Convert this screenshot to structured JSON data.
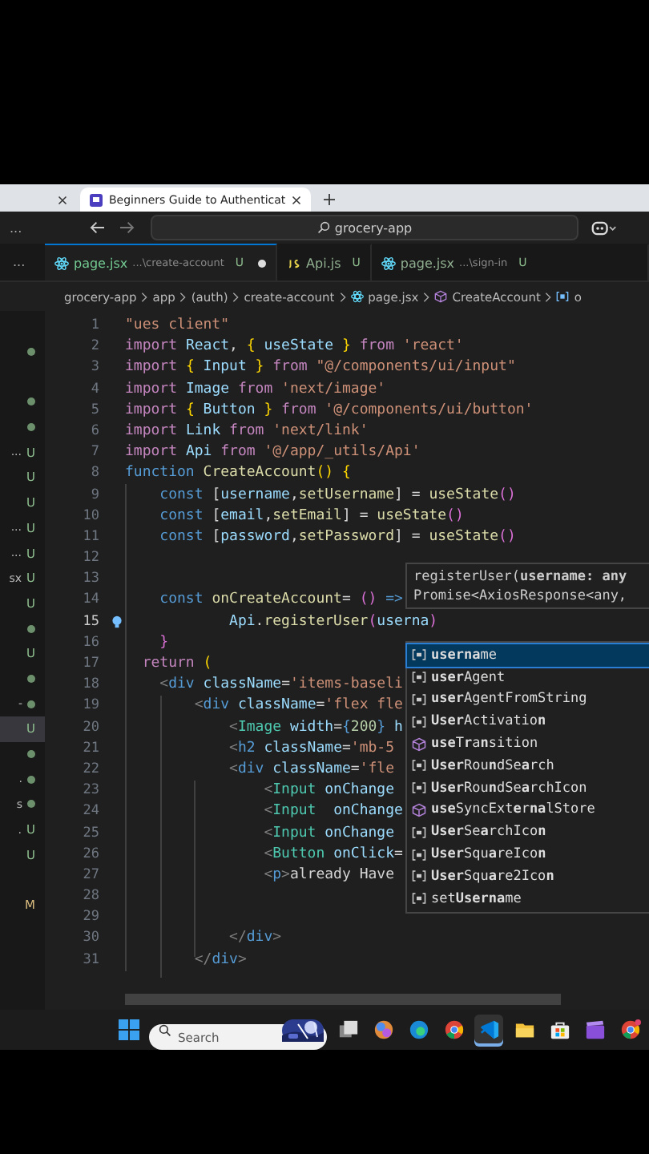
{
  "browser": {
    "tabs": [
      {
        "selected": false
      },
      {
        "title": "Beginners Guide to Authenticat",
        "selected": true
      }
    ]
  },
  "titlebar": {
    "menu": "...",
    "search": "grocery-app"
  },
  "tabs_menu": "...",
  "tabs": [
    {
      "kind": "react",
      "label": "page.jsx",
      "path": "...\\create-account",
      "status": "U",
      "dirty": true,
      "selected": true
    },
    {
      "kind": "js",
      "label": "Api.js",
      "status": "U",
      "dirty": false,
      "selected": false
    },
    {
      "kind": "react",
      "label": "page.jsx",
      "path": "...\\sign-in",
      "status": "U",
      "dirty": false,
      "selected": false
    }
  ],
  "breadcrumbs": [
    {
      "label": "grocery-app"
    },
    {
      "label": "app"
    },
    {
      "label": "(auth)"
    },
    {
      "label": "create-account"
    },
    {
      "kind": "react",
      "label": "page.jsx"
    },
    {
      "kind": "cube",
      "label": "CreateAccount"
    },
    {
      "kind": "var",
      "label": "o"
    }
  ],
  "sidebar": [
    {
      "kind": "empty",
      "selected": false
    },
    {
      "kind": "dot",
      "selected": false
    },
    {
      "kind": "empty",
      "selected": false
    },
    {
      "kind": "dot",
      "selected": false
    },
    {
      "kind": "dot",
      "selected": false
    },
    {
      "kind": "untracked",
      "prefix": "...",
      "status": "U",
      "selected": false
    },
    {
      "kind": "untracked",
      "status": "U",
      "selected": false
    },
    {
      "kind": "untracked",
      "status": "U",
      "selected": false
    },
    {
      "kind": "untracked",
      "prefix": "...",
      "status": "U",
      "selected": false
    },
    {
      "kind": "untracked",
      "prefix": "...",
      "status": "U",
      "selected": false
    },
    {
      "kind": "untracked",
      "prefix": "sx",
      "status": "U",
      "selected": false
    },
    {
      "kind": "untracked",
      "status": "U",
      "selected": false
    },
    {
      "kind": "dot",
      "selected": false
    },
    {
      "kind": "untracked",
      "status": "U",
      "selected": false
    },
    {
      "kind": "dot",
      "selected": false
    },
    {
      "kind": "dot",
      "prefix": "-",
      "selected": false
    },
    {
      "kind": "untracked",
      "status": "U",
      "selected": true
    },
    {
      "kind": "dot",
      "selected": false
    },
    {
      "kind": "dot",
      "prefix": ".",
      "selected": false
    },
    {
      "kind": "dot",
      "prefix": "s",
      "selected": false
    },
    {
      "kind": "untracked",
      "prefix": ".",
      "status": "U",
      "selected": false
    },
    {
      "kind": "untracked",
      "status": "U",
      "selected": false
    },
    {
      "kind": "empty",
      "selected": false
    },
    {
      "kind": "modified",
      "status": "M",
      "selected": false
    }
  ],
  "code": [
    {
      "n": "1",
      "tokens": [
        {
          "text": "\"ues client\"",
          "kind": "s"
        }
      ]
    },
    {
      "n": "2",
      "tokens": [
        {
          "text": "import ",
          "kind": "c"
        },
        {
          "text": "React",
          "kind": "v"
        },
        {
          "text": ", ",
          "kind": "p"
        },
        {
          "text": "{",
          "kind": "b"
        },
        {
          "text": " useState ",
          "kind": "v"
        },
        {
          "text": "}",
          "kind": "b"
        },
        {
          "text": " from ",
          "kind": "c"
        },
        {
          "text": "'react'",
          "kind": "s"
        }
      ]
    },
    {
      "n": "3",
      "tokens": [
        {
          "text": "import ",
          "kind": "c"
        },
        {
          "text": "{",
          "kind": "b"
        },
        {
          "text": " Input ",
          "kind": "v"
        },
        {
          "text": "}",
          "kind": "b"
        },
        {
          "text": " from ",
          "kind": "c"
        },
        {
          "text": "\"@/components/ui/input\"",
          "kind": "s"
        }
      ]
    },
    {
      "n": "4",
      "tokens": [
        {
          "text": "import ",
          "kind": "c"
        },
        {
          "text": "Image",
          "kind": "v"
        },
        {
          "text": " from ",
          "kind": "c"
        },
        {
          "text": "'next/image'",
          "kind": "s"
        }
      ]
    },
    {
      "n": "5",
      "tokens": [
        {
          "text": "import ",
          "kind": "c"
        },
        {
          "text": "{",
          "kind": "b"
        },
        {
          "text": " Button ",
          "kind": "v"
        },
        {
          "text": "}",
          "kind": "b"
        },
        {
          "text": " from ",
          "kind": "c"
        },
        {
          "text": "'@/components/ui/button'",
          "kind": "s"
        }
      ]
    },
    {
      "n": "6",
      "tokens": [
        {
          "text": "import ",
          "kind": "c"
        },
        {
          "text": "Link",
          "kind": "v"
        },
        {
          "text": " from ",
          "kind": "c"
        },
        {
          "text": "'next/link'",
          "kind": "s"
        }
      ]
    },
    {
      "n": "7",
      "tokens": [
        {
          "text": "import ",
          "kind": "c"
        },
        {
          "text": "Api",
          "kind": "v"
        },
        {
          "text": " from ",
          "kind": "c"
        },
        {
          "text": "'@/app/_utils/Api'",
          "kind": "s"
        }
      ]
    },
    {
      "n": "8",
      "tokens": [
        {
          "text": "function ",
          "kind": "k"
        },
        {
          "text": "CreateAccount",
          "kind": "f"
        },
        {
          "text": "() ",
          "kind": "b"
        },
        {
          "text": "{",
          "kind": "b"
        }
      ]
    },
    {
      "n": "9",
      "tokens": [
        {
          "text": "    const ",
          "kind": "k"
        },
        {
          "text": "[",
          "kind": "p"
        },
        {
          "text": "username",
          "kind": "v"
        },
        {
          "text": ",",
          "kind": "p"
        },
        {
          "text": "setUsername",
          "kind": "f"
        },
        {
          "text": "] = ",
          "kind": "p"
        },
        {
          "text": "useState",
          "kind": "f"
        },
        {
          "text": "()",
          "kind": "m"
        }
      ]
    },
    {
      "n": "10",
      "tokens": [
        {
          "text": "    const ",
          "kind": "k"
        },
        {
          "text": "[",
          "kind": "p"
        },
        {
          "text": "email",
          "kind": "v"
        },
        {
          "text": ",",
          "kind": "p"
        },
        {
          "text": "setEmail",
          "kind": "f"
        },
        {
          "text": "] = ",
          "kind": "p"
        },
        {
          "text": "useState",
          "kind": "f"
        },
        {
          "text": "()",
          "kind": "m"
        }
      ]
    },
    {
      "n": "11",
      "tokens": [
        {
          "text": "    const ",
          "kind": "k"
        },
        {
          "text": "[",
          "kind": "p"
        },
        {
          "text": "password",
          "kind": "v"
        },
        {
          "text": ",",
          "kind": "p"
        },
        {
          "text": "setPassword",
          "kind": "f"
        },
        {
          "text": "] = ",
          "kind": "p"
        },
        {
          "text": "useState",
          "kind": "f"
        },
        {
          "text": "()",
          "kind": "m"
        }
      ]
    },
    {
      "n": "12"
    },
    {
      "n": "13"
    },
    {
      "n": "14",
      "tokens": [
        {
          "text": "    const ",
          "kind": "k"
        },
        {
          "text": "onCreateAccount",
          "kind": "f"
        },
        {
          "text": "= ",
          "kind": "p"
        },
        {
          "text": "()",
          "kind": "m"
        },
        {
          "text": " =>",
          "kind": "k"
        }
      ]
    },
    {
      "n": "15",
      "current": true,
      "tokens": [
        {
          "text": "            Api",
          "kind": "v"
        },
        {
          "text": ".",
          "kind": "p"
        },
        {
          "text": "registerUser",
          "kind": "f"
        },
        {
          "text": "(",
          "kind": "m"
        },
        {
          "text": "userna",
          "kind": "v"
        },
        {
          "text": ")",
          "kind": "m"
        }
      ]
    },
    {
      "n": "16",
      "tokens": [
        {
          "text": "    }",
          "kind": "m"
        }
      ]
    },
    {
      "n": "17",
      "tokens": [
        {
          "text": "  return ",
          "kind": "c"
        },
        {
          "text": "(",
          "kind": "b"
        }
      ]
    },
    {
      "n": "18",
      "tokens": [
        {
          "text": "    <",
          "kind": "g"
        },
        {
          "text": "div ",
          "kind": "k"
        },
        {
          "text": "className",
          "kind": "a"
        },
        {
          "text": "=",
          "kind": "p"
        },
        {
          "text": "'items-baseli",
          "kind": "s"
        }
      ]
    },
    {
      "n": "19",
      "tokens": [
        {
          "text": "        <",
          "kind": "g"
        },
        {
          "text": "div ",
          "kind": "k"
        },
        {
          "text": "className",
          "kind": "a"
        },
        {
          "text": "=",
          "kind": "p"
        },
        {
          "text": "'flex fle",
          "kind": "s"
        }
      ]
    },
    {
      "n": "20",
      "tokens": [
        {
          "text": "            <",
          "kind": "g"
        },
        {
          "text": "Image ",
          "kind": "t"
        },
        {
          "text": "width",
          "kind": "a"
        },
        {
          "text": "=",
          "kind": "p"
        },
        {
          "text": "{",
          "kind": "k"
        },
        {
          "text": "200",
          "kind": "n"
        },
        {
          "text": "}",
          "kind": "k"
        },
        {
          "text": " h",
          "kind": "a"
        }
      ]
    },
    {
      "n": "21",
      "tokens": [
        {
          "text": "            <",
          "kind": "g"
        },
        {
          "text": "h2 ",
          "kind": "k"
        },
        {
          "text": "className",
          "kind": "a"
        },
        {
          "text": "=",
          "kind": "p"
        },
        {
          "text": "'mb-5",
          "kind": "s"
        }
      ]
    },
    {
      "n": "22",
      "tokens": [
        {
          "text": "            <",
          "kind": "g"
        },
        {
          "text": "div ",
          "kind": "k"
        },
        {
          "text": "className",
          "kind": "a"
        },
        {
          "text": "=",
          "kind": "p"
        },
        {
          "text": "'fle",
          "kind": "s"
        }
      ]
    },
    {
      "n": "23",
      "tokens": [
        {
          "text": "                <",
          "kind": "g"
        },
        {
          "text": "Input ",
          "kind": "t"
        },
        {
          "text": "onChange",
          "kind": "a"
        }
      ]
    },
    {
      "n": "24",
      "tokens": [
        {
          "text": "                <",
          "kind": "g"
        },
        {
          "text": "Input  ",
          "kind": "t"
        },
        {
          "text": "onChange",
          "kind": "a"
        }
      ]
    },
    {
      "n": "25",
      "tokens": [
        {
          "text": "                <",
          "kind": "g"
        },
        {
          "text": "Input ",
          "kind": "t"
        },
        {
          "text": "onChange",
          "kind": "a"
        }
      ]
    },
    {
      "n": "26",
      "tokens": [
        {
          "text": "                <",
          "kind": "g"
        },
        {
          "text": "Button ",
          "kind": "t"
        },
        {
          "text": "onClick",
          "kind": "a"
        },
        {
          "text": "=",
          "kind": "p"
        }
      ]
    },
    {
      "n": "27",
      "tokens": [
        {
          "text": "                <",
          "kind": "g"
        },
        {
          "text": "p",
          "kind": "k"
        },
        {
          "text": ">",
          "kind": "g"
        },
        {
          "text": "already Have",
          "kind": "p"
        }
      ]
    },
    {
      "n": "28"
    },
    {
      "n": "29"
    },
    {
      "n": "30",
      "tokens": [
        {
          "text": "            </",
          "kind": "g"
        },
        {
          "text": "div",
          "kind": "k"
        },
        {
          "text": ">",
          "kind": "g"
        }
      ]
    },
    {
      "n": "31",
      "tokens": [
        {
          "text": "        </",
          "kind": "g"
        },
        {
          "text": "div",
          "kind": "k"
        },
        {
          "text": ">",
          "kind": "g"
        }
      ]
    }
  ],
  "hover": {
    "lines": [
      "registerUser(**username: any**",
      "Promise<AxiosResponse<any,"
    ]
  },
  "suggestions": [
    {
      "kind": "var",
      "label": "**userna**me",
      "selected": true
    },
    {
      "kind": "var",
      "label": "**user**Agent",
      "selected": false
    },
    {
      "kind": "var",
      "label": "**user**AgentFromString",
      "selected": false
    },
    {
      "kind": "var",
      "label": "**User**Activatio**n**",
      "selected": false
    },
    {
      "kind": "cube",
      "label": "**use**T**r**a**n**sition",
      "selected": false
    },
    {
      "kind": "var",
      "label": "**User**Rou**n**dSe**a**rch",
      "selected": false
    },
    {
      "kind": "var",
      "label": "**User**Rou**n**dSe**a**rchIcon",
      "selected": false
    },
    {
      "kind": "cube",
      "label": "**use**SyncExt**e**r**na**lStore",
      "selected": false
    },
    {
      "kind": "var",
      "label": "**User**Se**a**rchIco**n**",
      "selected": false
    },
    {
      "kind": "var",
      "label": "**User**Squ**a**reIco**n**",
      "selected": false
    },
    {
      "kind": "var",
      "label": "**User**Squ**a**re2Ico**n**",
      "selected": false
    },
    {
      "kind": "var",
      "label": "set**Userna**me",
      "selected": false
    }
  ],
  "taskbar": {
    "search": {
      "placeholder": "Search"
    },
    "apps": [
      {
        "kind": "windows",
        "selected": false
      },
      {
        "kind": "taskview",
        "selected": false
      },
      {
        "kind": "swirl",
        "selected": false
      },
      {
        "kind": "edge",
        "selected": false
      },
      {
        "kind": "chrome",
        "selected": false
      },
      {
        "kind": "code",
        "selected": true
      },
      {
        "kind": "folder",
        "selected": false
      },
      {
        "kind": "store",
        "selected": false
      },
      {
        "kind": "film",
        "selected": false
      },
      {
        "kind": "chrome-badge",
        "selected": false
      }
    ]
  }
}
